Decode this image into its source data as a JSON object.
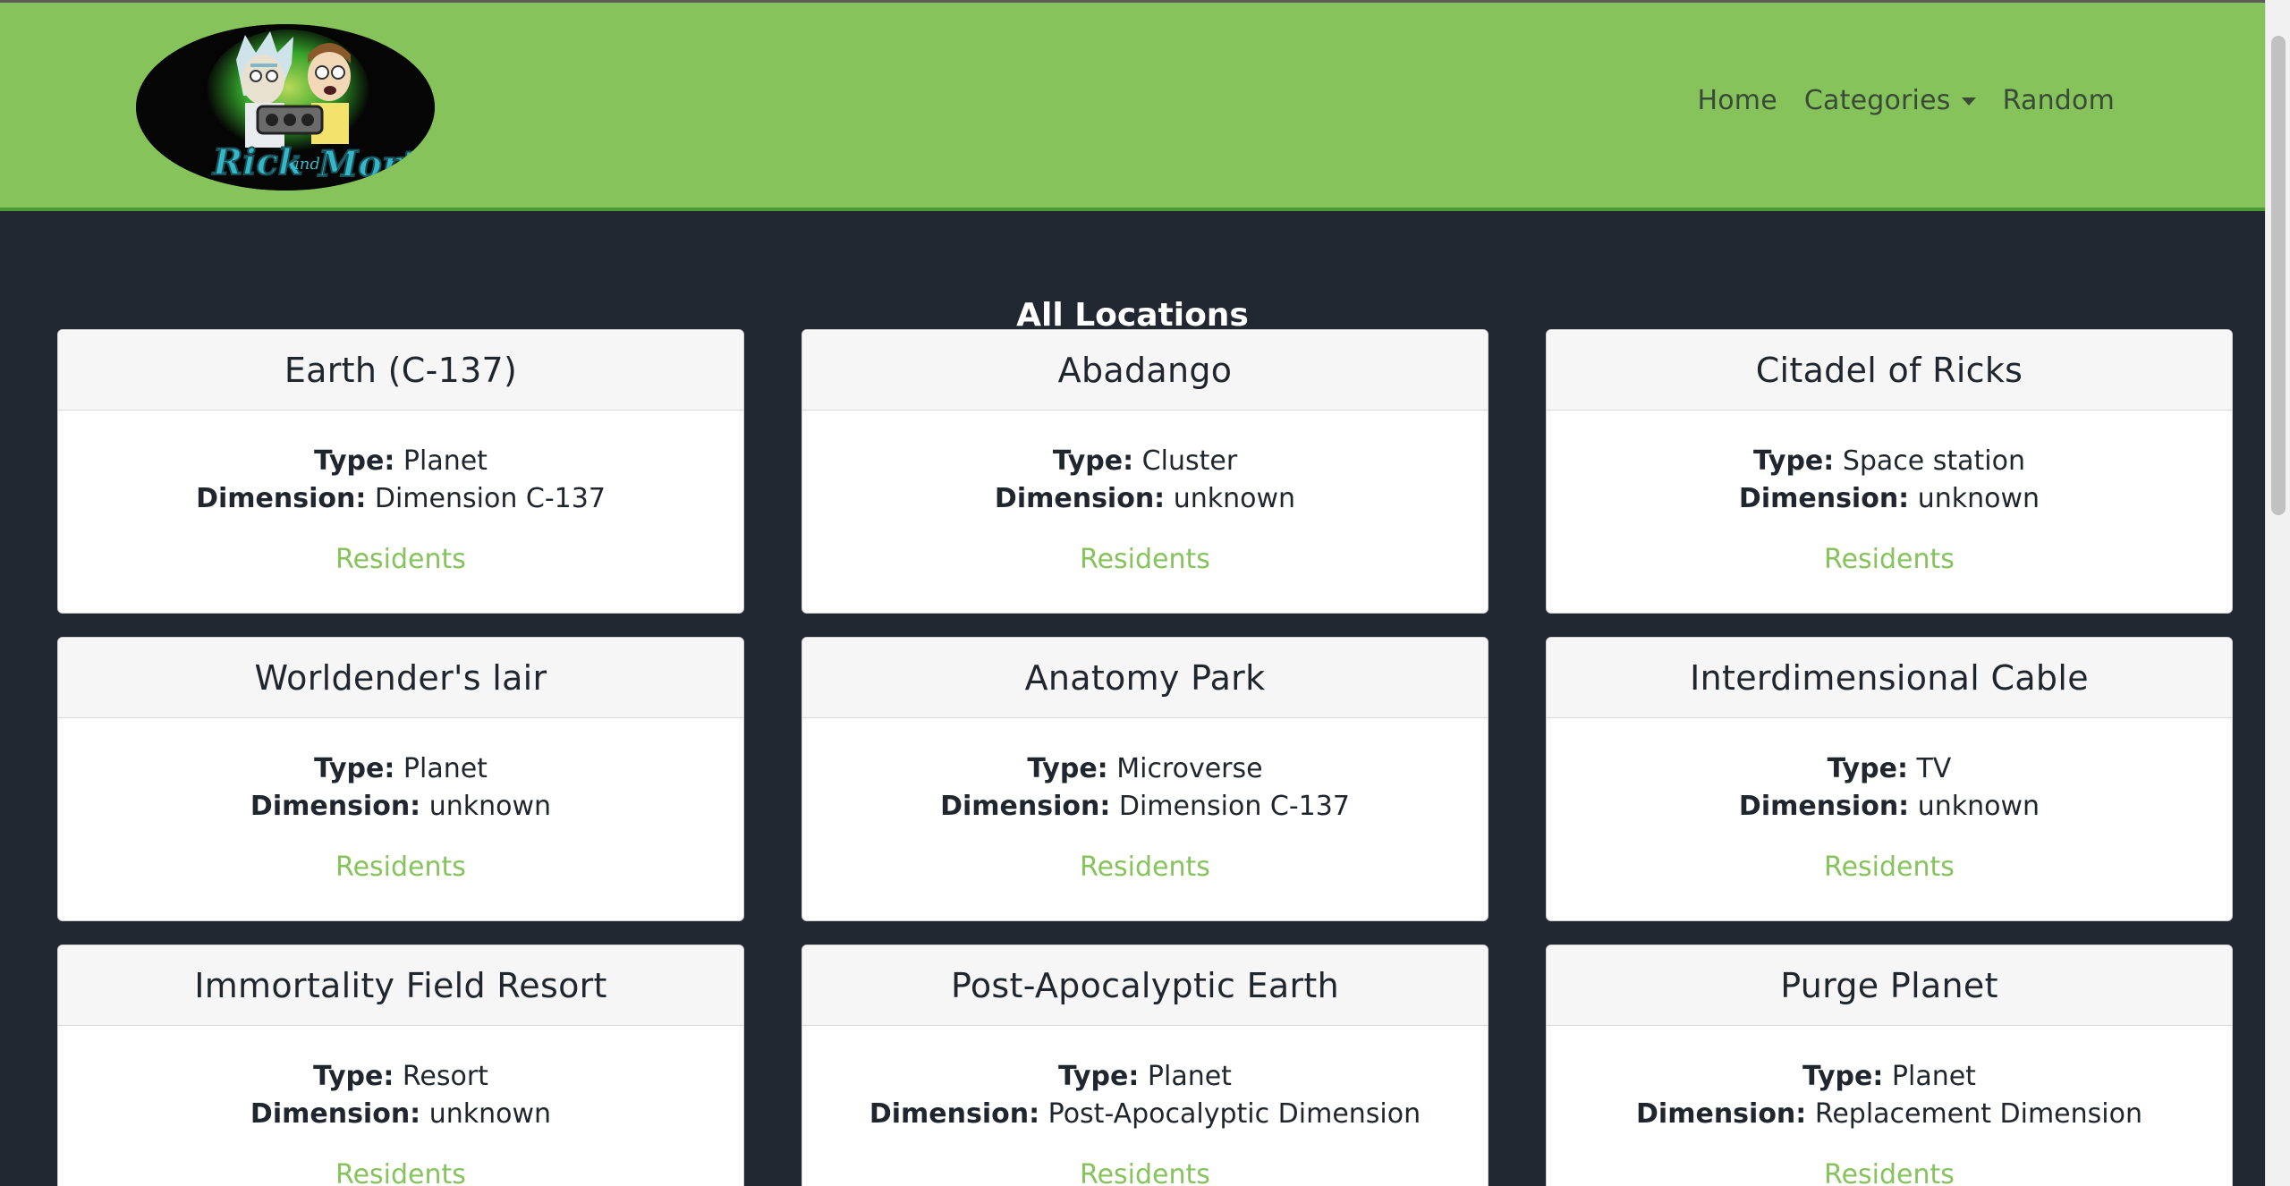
{
  "header": {
    "nav": {
      "home": "Home",
      "categories": "Categories",
      "random": "Random"
    }
  },
  "page": {
    "title": "All Locations"
  },
  "labels": {
    "type": "Type:",
    "dimension": "Dimension:",
    "residents": "Residents"
  },
  "locations": [
    {
      "name": "Earth (C-137)",
      "type": "Planet",
      "dimension": "Dimension C-137"
    },
    {
      "name": "Abadango",
      "type": "Cluster",
      "dimension": "unknown"
    },
    {
      "name": "Citadel of Ricks",
      "type": "Space station",
      "dimension": "unknown"
    },
    {
      "name": "Worldender's lair",
      "type": "Planet",
      "dimension": "unknown"
    },
    {
      "name": "Anatomy Park",
      "type": "Microverse",
      "dimension": "Dimension C-137"
    },
    {
      "name": "Interdimensional Cable",
      "type": "TV",
      "dimension": "unknown"
    },
    {
      "name": "Immortality Field Resort",
      "type": "Resort",
      "dimension": "unknown"
    },
    {
      "name": "Post-Apocalyptic Earth",
      "type": "Planet",
      "dimension": "Post-Apocalyptic Dimension"
    },
    {
      "name": "Purge Planet",
      "type": "Planet",
      "dimension": "Replacement Dimension"
    }
  ],
  "colors": {
    "navbar": "#86c35b",
    "background": "#222831",
    "link": "#86c35b"
  }
}
